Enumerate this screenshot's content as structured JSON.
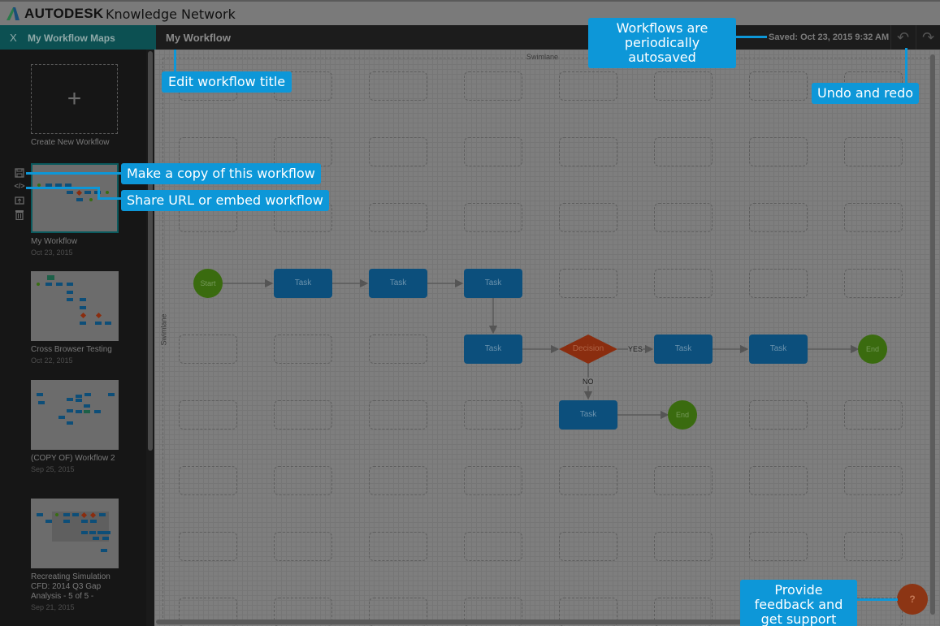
{
  "topbar": {
    "brand": "AUTODESK",
    "product": "Knowledge Network"
  },
  "navbar": {
    "close_glyph": "X",
    "maps_tab_label": "My Workflow Maps",
    "workflow_title": "My Workflow",
    "saved_status": "Saved: Oct 23, 2015 9:32 AM",
    "undo_icon": "↶",
    "redo_icon": "↷"
  },
  "sidebar": {
    "create_glyph": "+",
    "create_label": "Create New Workflow",
    "tools": {
      "save_icon": "💾",
      "embed_icon": "</>",
      "share_icon": "⇪",
      "delete_icon": "🗑"
    },
    "workflows": [
      {
        "title": "My Workflow",
        "date": "Oct 23, 2015",
        "selected": true
      },
      {
        "title": "Cross Browser Testing",
        "date": "Oct 22, 2015"
      },
      {
        "title": "(COPY OF) Workflow 2",
        "date": "Sep 25, 2015"
      },
      {
        "title": "Recreating Simulation CFD: 2014 Q3 Gap Analysis - 5 of 5 -",
        "date": "Sep 21, 2015"
      }
    ]
  },
  "canvas": {
    "swimlane_label": "Swimlane",
    "nodes": {
      "start": "Start",
      "task": "Task",
      "decision": "Decision",
      "end": "End"
    },
    "edge_labels": {
      "yes": "YES",
      "no": "NO"
    },
    "colors": {
      "task": "#0c4f7c",
      "start_end": "#3a6b0f",
      "decision": "#8a2d0f"
    }
  },
  "help": {
    "glyph": "?"
  },
  "callouts": {
    "edit_title": "Edit workflow title",
    "autosave": "Workflows are periodically autosaved",
    "undo_redo": "Undo and redo",
    "copy": "Make a copy of this workflow",
    "share": "Share URL or embed workflow",
    "feedback": "Provide feedback and get support",
    "accent": "#0d97d8"
  }
}
